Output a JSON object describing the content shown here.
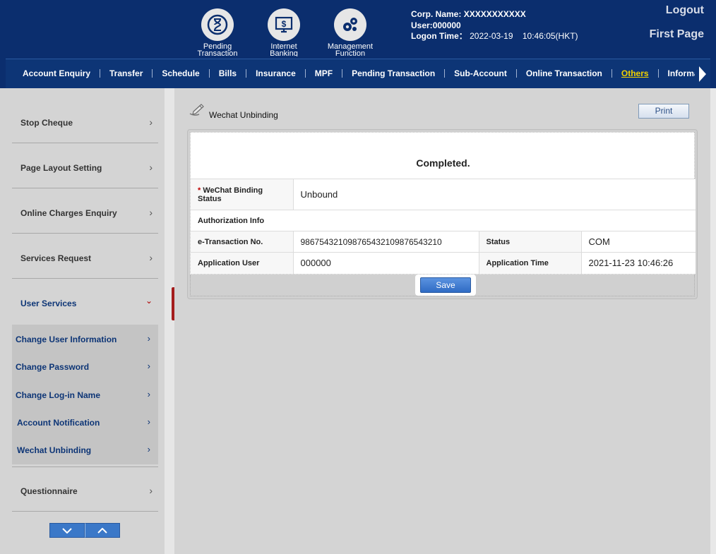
{
  "header": {
    "icons": [
      {
        "name": "pending-transaction",
        "label": "Pending\nTransaction"
      },
      {
        "name": "internet-banking",
        "label": "Internet\nBanking"
      },
      {
        "name": "management-function",
        "label": "Management\nFunction"
      }
    ],
    "corp_label": "Corp. Name:",
    "corp_value": "XXXXXXXXXXX",
    "user_label": "User:",
    "user_value": "000000",
    "logon_label": "Logon Time：",
    "logon_value": "2022-03-19    10:46:05(HKT)",
    "logout": "Logout",
    "first_page": "First Page"
  },
  "nav": {
    "items": [
      "Account Enquiry",
      "Transfer",
      "Schedule",
      "Bills",
      "Insurance",
      "MPF",
      "Pending Transaction",
      "Sub-Account",
      "Online Transaction",
      "Others",
      "Informat"
    ],
    "active": "Others"
  },
  "sidebar": {
    "items": [
      {
        "label": "Stop Cheque"
      },
      {
        "label": "Page Layout Setting"
      },
      {
        "label": "Online Charges Enquiry"
      },
      {
        "label": "Services Request"
      },
      {
        "label": "User Services"
      },
      {
        "label": "Questionnaire"
      }
    ],
    "subitems": [
      {
        "label": "Change User Information"
      },
      {
        "label": "Change Password"
      },
      {
        "label": "Change Log-in Name"
      },
      {
        "label": "Account Notification"
      },
      {
        "label": "Wechat Unbinding"
      }
    ]
  },
  "main": {
    "title": "Wechat Unbinding",
    "print": "Print",
    "completed": "Completed.",
    "binding_label": "WeChat Binding Status",
    "binding_value": "Unbound",
    "auth_header": "Authorization Info",
    "etx_label": "e-Transaction No.",
    "etx_value": "98675432109876543210987654321​0",
    "status_label": "Status",
    "status_value": "COM",
    "app_user_label": "Application User",
    "app_user_value": "000000",
    "app_time_label": "Application Time",
    "app_time_value": "2021-11-23 10:46:26",
    "save": "Save"
  }
}
